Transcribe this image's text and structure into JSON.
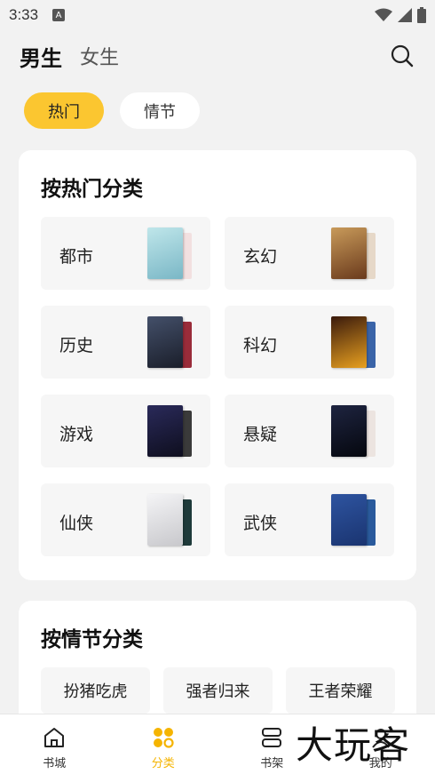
{
  "status_bar": {
    "time": "3:33"
  },
  "header": {
    "tabs": [
      {
        "label": "男生",
        "active": true
      },
      {
        "label": "女生",
        "active": false
      }
    ]
  },
  "filter_chips": [
    {
      "label": "热门",
      "active": true
    },
    {
      "label": "情节",
      "active": false
    }
  ],
  "hot_section": {
    "title": "按热门分类",
    "categories": [
      {
        "label": "都市",
        "cover_colors": [
          "#9ad0d6",
          "#f2e0e0"
        ]
      },
      {
        "label": "玄幻",
        "cover_colors": [
          "#8a5a2c",
          "#e6d8c8"
        ]
      },
      {
        "label": "历史",
        "cover_colors": [
          "#2a2e3c",
          "#9a2c3a"
        ]
      },
      {
        "label": "科幻",
        "cover_colors": [
          "#1c0f08",
          "#3a64a8"
        ]
      },
      {
        "label": "游戏",
        "cover_colors": [
          "#1e1e3c",
          "#3a3a3a"
        ]
      },
      {
        "label": "悬疑",
        "cover_colors": [
          "#0a0d1c",
          "#ece4e0"
        ]
      },
      {
        "label": "仙侠",
        "cover_colors": [
          "#e8e8ea",
          "#1e3a3a"
        ]
      },
      {
        "label": "武侠",
        "cover_colors": [
          "#24448a",
          "#2a5a9c"
        ]
      }
    ]
  },
  "plot_section": {
    "title": "按情节分类",
    "items": [
      "扮猪吃虎",
      "强者归来",
      "王者荣耀"
    ]
  },
  "bottom_nav": [
    {
      "label": "书城",
      "icon": "home-icon",
      "active": false
    },
    {
      "label": "分类",
      "icon": "category-icon",
      "active": true
    },
    {
      "label": "书架",
      "icon": "bookshelf-icon",
      "active": false
    },
    {
      "label": "我的",
      "icon": "profile-icon",
      "active": false
    }
  ],
  "watermark": "大玩客",
  "colors": {
    "accent": "#fbc630",
    "active_nav": "#f5b400",
    "background": "#f2f2f2"
  }
}
